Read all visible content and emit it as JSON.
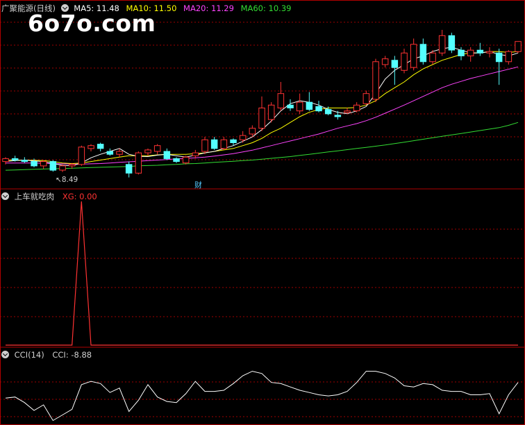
{
  "watermark": "6o7o.com",
  "main_panel": {
    "title": "广聚能源(日线)",
    "ma_labels": [
      {
        "text": "MA5: 11.48",
        "color": "#ffffff"
      },
      {
        "text": "MA10: 11.50",
        "color": "#ffff00"
      },
      {
        "text": "MA20: 11.29",
        "color": "#ff44ff"
      },
      {
        "text": "MA60: 10.39",
        "color": "#33dd33"
      }
    ],
    "low_marker": "8.49",
    "finance_badge": "财"
  },
  "indicator_panel": {
    "title": "上车就吃肉",
    "value_label": "XG: 0.00"
  },
  "cci_panel": {
    "title": "CCI(14)",
    "value_label": "CCI: -8.88"
  },
  "colors": {
    "up": "#ff3232",
    "down": "#54ffff",
    "grid": "#a00000",
    "border": "#b00000",
    "ma5": "#ffffff",
    "ma10": "#ffff00",
    "ma20": "#ff44ff",
    "ma60": "#33dd33",
    "xg": "#ff3232",
    "cci": "#ffffff"
  },
  "chart_data": [
    {
      "type": "candlestick",
      "title": "广聚能源(日线)",
      "ylim": [
        8.0,
        14.0
      ],
      "ohlc": [
        [
          8.85,
          9.0,
          8.75,
          8.95
        ],
        [
          8.95,
          9.05,
          8.85,
          8.9
        ],
        [
          8.9,
          9.0,
          8.8,
          8.85
        ],
        [
          8.85,
          8.95,
          8.65,
          8.7
        ],
        [
          8.7,
          8.9,
          8.6,
          8.85
        ],
        [
          8.85,
          8.9,
          8.5,
          8.55
        ],
        [
          8.55,
          8.75,
          8.49,
          8.7
        ],
        [
          8.7,
          8.8,
          8.6,
          8.75
        ],
        [
          8.75,
          9.4,
          8.7,
          9.35
        ],
        [
          9.3,
          9.45,
          9.2,
          9.4
        ],
        [
          9.45,
          9.5,
          9.2,
          9.3
        ],
        [
          9.2,
          9.3,
          9.05,
          9.1
        ],
        [
          9.1,
          9.3,
          9.0,
          9.2
        ],
        [
          8.75,
          8.85,
          8.3,
          8.45
        ],
        [
          8.45,
          9.2,
          8.4,
          9.15
        ],
        [
          9.15,
          9.3,
          9.05,
          9.25
        ],
        [
          9.2,
          9.45,
          9.1,
          9.4
        ],
        [
          9.2,
          9.3,
          8.9,
          8.95
        ],
        [
          8.95,
          9.0,
          8.8,
          8.85
        ],
        [
          8.8,
          9.05,
          8.75,
          9.0
        ],
        [
          9.05,
          9.25,
          8.95,
          9.15
        ],
        [
          9.2,
          9.7,
          9.1,
          9.6
        ],
        [
          9.6,
          9.7,
          9.25,
          9.3
        ],
        [
          9.3,
          9.7,
          9.25,
          9.6
        ],
        [
          9.6,
          9.65,
          9.4,
          9.5
        ],
        [
          9.6,
          9.9,
          9.5,
          9.75
        ],
        [
          9.8,
          10.1,
          9.7,
          10.0
        ],
        [
          10.0,
          11.1,
          9.9,
          10.7
        ],
        [
          10.3,
          10.9,
          10.2,
          10.8
        ],
        [
          10.7,
          11.6,
          10.6,
          11.2
        ],
        [
          10.8,
          11.0,
          10.6,
          10.7
        ],
        [
          10.6,
          11.2,
          10.5,
          10.9
        ],
        [
          10.9,
          11.25,
          10.6,
          10.65
        ],
        [
          10.75,
          10.95,
          10.55,
          10.6
        ],
        [
          10.65,
          10.75,
          10.45,
          10.5
        ],
        [
          10.45,
          10.6,
          10.3,
          10.4
        ],
        [
          10.55,
          10.7,
          10.5,
          10.6
        ],
        [
          10.6,
          10.9,
          10.55,
          10.8
        ],
        [
          10.85,
          11.3,
          10.8,
          11.2
        ],
        [
          11.0,
          12.4,
          10.9,
          12.3
        ],
        [
          12.2,
          12.5,
          12.1,
          12.4
        ],
        [
          12.35,
          12.5,
          11.5,
          12.1
        ],
        [
          12.0,
          12.75,
          11.9,
          12.6
        ],
        [
          12.1,
          13.1,
          12.0,
          12.9
        ],
        [
          12.9,
          13.1,
          12.2,
          12.3
        ],
        [
          12.3,
          12.7,
          12.2,
          12.6
        ],
        [
          12.6,
          13.4,
          12.5,
          13.2
        ],
        [
          13.2,
          13.3,
          12.6,
          12.7
        ],
        [
          12.7,
          12.8,
          12.35,
          12.5
        ],
        [
          12.5,
          12.8,
          12.3,
          12.7
        ],
        [
          12.7,
          12.95,
          12.5,
          12.6
        ],
        [
          12.6,
          12.8,
          12.45,
          12.65
        ],
        [
          12.6,
          12.75,
          11.5,
          12.3
        ],
        [
          12.3,
          12.7,
          12.2,
          12.65
        ],
        [
          12.65,
          13.0,
          12.6,
          13.0
        ]
      ],
      "ma5": [
        8.85,
        8.88,
        8.9,
        8.87,
        8.85,
        8.78,
        8.72,
        8.7,
        8.8,
        8.98,
        9.1,
        9.2,
        9.3,
        9.1,
        9.03,
        9.02,
        9.07,
        9.1,
        9.05,
        9.0,
        9.07,
        9.15,
        9.2,
        9.3,
        9.4,
        9.55,
        9.7,
        9.95,
        10.25,
        10.6,
        10.85,
        10.95,
        10.9,
        10.8,
        10.65,
        10.55,
        10.5,
        10.6,
        10.75,
        11.2,
        11.7,
        12.0,
        12.2,
        12.4,
        12.5,
        12.65,
        12.75,
        12.8,
        12.7,
        12.6,
        12.6,
        12.65,
        12.55,
        12.5,
        12.6
      ],
      "ma10": [
        8.9,
        8.9,
        8.9,
        8.89,
        8.88,
        8.85,
        8.8,
        8.78,
        8.8,
        8.85,
        8.9,
        8.95,
        9.0,
        9.05,
        9.05,
        9.05,
        9.08,
        9.1,
        9.1,
        9.1,
        9.12,
        9.15,
        9.2,
        9.25,
        9.3,
        9.4,
        9.5,
        9.65,
        9.85,
        10.0,
        10.2,
        10.4,
        10.55,
        10.65,
        10.7,
        10.7,
        10.7,
        10.72,
        10.8,
        10.95,
        11.2,
        11.4,
        11.6,
        11.85,
        12.05,
        12.2,
        12.35,
        12.45,
        12.55,
        12.6,
        12.6,
        12.65,
        12.65,
        12.62,
        12.65
      ],
      "ma20": [
        8.8,
        8.8,
        8.8,
        8.8,
        8.79,
        8.78,
        8.77,
        8.76,
        8.76,
        8.77,
        8.78,
        8.8,
        8.82,
        8.84,
        8.86,
        8.88,
        8.9,
        8.92,
        8.94,
        8.96,
        8.98,
        9.0,
        9.04,
        9.08,
        9.12,
        9.18,
        9.24,
        9.32,
        9.4,
        9.48,
        9.56,
        9.64,
        9.72,
        9.8,
        9.9,
        10.0,
        10.08,
        10.16,
        10.26,
        10.38,
        10.52,
        10.66,
        10.8,
        10.95,
        11.1,
        11.25,
        11.4,
        11.52,
        11.62,
        11.72,
        11.8,
        11.88,
        11.96,
        12.04,
        12.12
      ],
      "ma60": [
        8.55,
        8.56,
        8.57,
        8.58,
        8.59,
        8.6,
        8.61,
        8.62,
        8.63,
        8.64,
        8.65,
        8.66,
        8.67,
        8.68,
        8.7,
        8.71,
        8.72,
        8.74,
        8.75,
        8.77,
        8.78,
        8.8,
        8.82,
        8.84,
        8.86,
        8.88,
        8.9,
        8.93,
        8.96,
        8.99,
        9.02,
        9.06,
        9.1,
        9.14,
        9.18,
        9.22,
        9.26,
        9.3,
        9.34,
        9.38,
        9.42,
        9.47,
        9.52,
        9.57,
        9.62,
        9.67,
        9.72,
        9.77,
        9.82,
        9.87,
        9.92,
        9.97,
        10.02,
        10.1,
        10.2
      ]
    },
    {
      "type": "line",
      "title": "上车就吃肉",
      "series": [
        {
          "name": "XG",
          "values": [
            0,
            0,
            0,
            0,
            0,
            0,
            0,
            0,
            1,
            0,
            0,
            0,
            0,
            0,
            0,
            0,
            0,
            0,
            0,
            0,
            0,
            0,
            0,
            0,
            0,
            0,
            0,
            0,
            0,
            0,
            0,
            0,
            0,
            0,
            0,
            0,
            0,
            0,
            0,
            0,
            0,
            0,
            0,
            0,
            0,
            0,
            0,
            0,
            0,
            0,
            0,
            0,
            0,
            0,
            0
          ]
        }
      ],
      "ylim": [
        0,
        1
      ]
    },
    {
      "type": "line",
      "title": "CCI(14)",
      "series": [
        {
          "name": "CCI",
          "values": [
            -40,
            -35,
            -60,
            -95,
            -70,
            -140,
            -115,
            -90,
            20,
            35,
            25,
            -15,
            5,
            -100,
            -50,
            20,
            -35,
            -55,
            -60,
            -20,
            35,
            -10,
            -10,
            -5,
            25,
            60,
            80,
            70,
            30,
            25,
            10,
            -5,
            -15,
            -25,
            -30,
            -25,
            -10,
            30,
            80,
            80,
            70,
            50,
            15,
            10,
            25,
            20,
            -5,
            -10,
            -10,
            -25,
            -25,
            -20,
            -110,
            -25,
            30
          ]
        }
      ],
      "ylim": [
        -160,
        150
      ]
    }
  ]
}
